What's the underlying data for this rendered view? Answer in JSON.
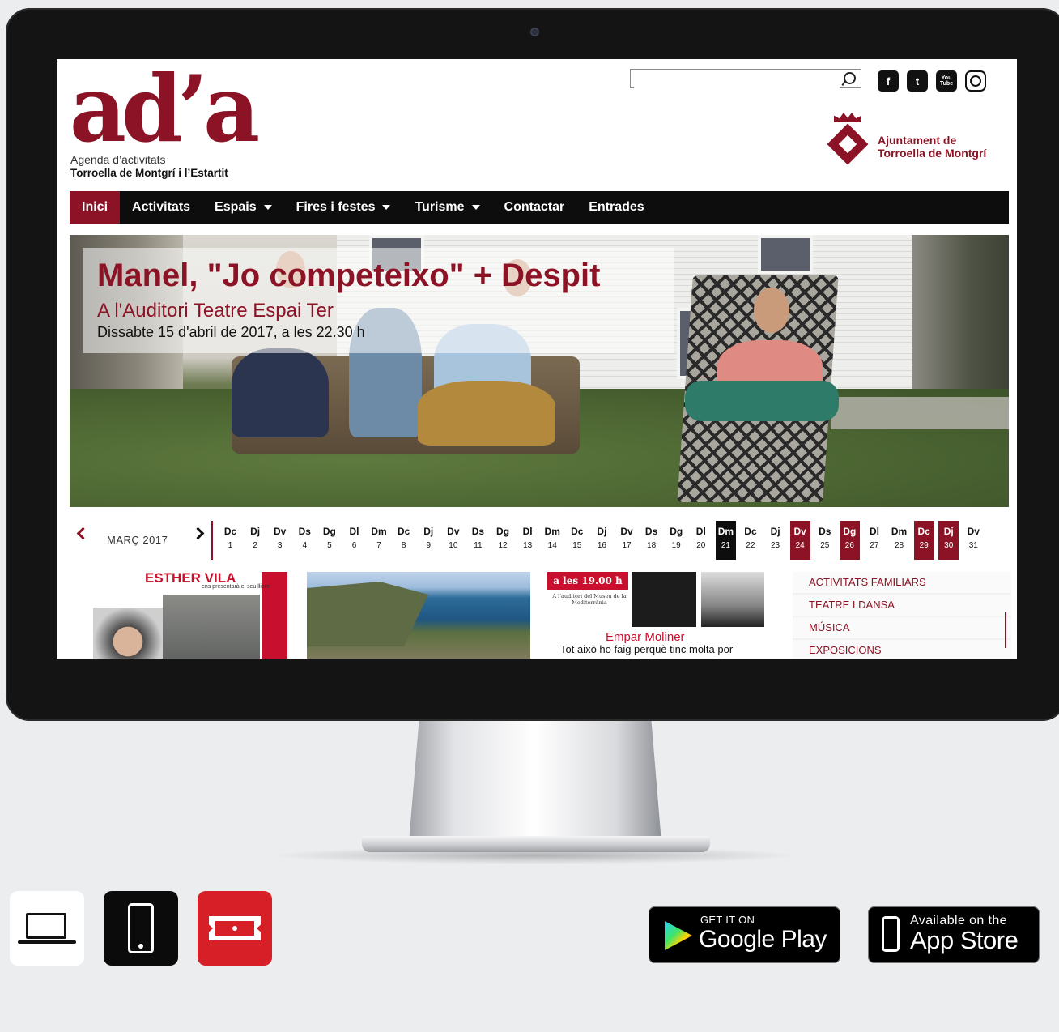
{
  "logo": {
    "mark": "ad’a",
    "subtitle": "Agenda d’activitats",
    "place": "Torroella de Montgrí i l’Estartit"
  },
  "search": {
    "value": "",
    "placeholder": ""
  },
  "social": [
    {
      "icon": "facebook-icon",
      "glyph": "f"
    },
    {
      "icon": "twitter-icon",
      "glyph": "t"
    },
    {
      "icon": "youtube-icon",
      "glyph": "You Tube"
    },
    {
      "icon": "instagram-icon",
      "glyph": ""
    }
  ],
  "council": {
    "line1": "Ajuntament de",
    "line2": "Torroella de Montgrí"
  },
  "nav": {
    "items": [
      {
        "label": "Inici",
        "active": true,
        "dropdown": false
      },
      {
        "label": "Activitats",
        "active": false,
        "dropdown": false
      },
      {
        "label": "Espais",
        "active": false,
        "dropdown": true
      },
      {
        "label": "Fires i festes",
        "active": false,
        "dropdown": true
      },
      {
        "label": "Turisme",
        "active": false,
        "dropdown": true
      },
      {
        "label": "Contactar",
        "active": false,
        "dropdown": false
      },
      {
        "label": "Entrades",
        "active": false,
        "dropdown": false
      }
    ]
  },
  "hero": {
    "title": "Manel, \"Jo competeixo\" + Despit",
    "subtitle": "A l'Auditori Teatre Espai Ter",
    "date": "Dissabte 15 d'abril de 2017, a les 22.30 h"
  },
  "calendar": {
    "month": "MARÇ 2017",
    "days": [
      {
        "n": "Dc",
        "d": "1",
        "s": ""
      },
      {
        "n": "Dj",
        "d": "2",
        "s": ""
      },
      {
        "n": "Dv",
        "d": "3",
        "s": ""
      },
      {
        "n": "Ds",
        "d": "4",
        "s": ""
      },
      {
        "n": "Dg",
        "d": "5",
        "s": ""
      },
      {
        "n": "Dl",
        "d": "6",
        "s": ""
      },
      {
        "n": "Dm",
        "d": "7",
        "s": ""
      },
      {
        "n": "Dc",
        "d": "8",
        "s": ""
      },
      {
        "n": "Dj",
        "d": "9",
        "s": ""
      },
      {
        "n": "Dv",
        "d": "10",
        "s": ""
      },
      {
        "n": "Ds",
        "d": "11",
        "s": ""
      },
      {
        "n": "Dg",
        "d": "12",
        "s": ""
      },
      {
        "n": "Dl",
        "d": "13",
        "s": ""
      },
      {
        "n": "Dm",
        "d": "14",
        "s": ""
      },
      {
        "n": "Dc",
        "d": "15",
        "s": ""
      },
      {
        "n": "Dj",
        "d": "16",
        "s": ""
      },
      {
        "n": "Dv",
        "d": "17",
        "s": ""
      },
      {
        "n": "Ds",
        "d": "18",
        "s": ""
      },
      {
        "n": "Dg",
        "d": "19",
        "s": ""
      },
      {
        "n": "Dl",
        "d": "20",
        "s": ""
      },
      {
        "n": "Dm",
        "d": "21",
        "s": "today"
      },
      {
        "n": "Dc",
        "d": "22",
        "s": ""
      },
      {
        "n": "Dj",
        "d": "23",
        "s": ""
      },
      {
        "n": "Dv",
        "d": "24",
        "s": "hl"
      },
      {
        "n": "Ds",
        "d": "25",
        "s": ""
      },
      {
        "n": "Dg",
        "d": "26",
        "s": "hl"
      },
      {
        "n": "Dl",
        "d": "27",
        "s": ""
      },
      {
        "n": "Dm",
        "d": "28",
        "s": ""
      },
      {
        "n": "Dc",
        "d": "29",
        "s": "hl"
      },
      {
        "n": "Dj",
        "d": "30",
        "s": "hl"
      },
      {
        "n": "Dv",
        "d": "31",
        "s": ""
      }
    ]
  },
  "cards": {
    "c1": {
      "title": "ESTHER VILA",
      "small": "ens presentarà el seu llibre"
    },
    "c3": {
      "banner": "a les 19.00 h",
      "info": "A l'auditori del Museu de la Mediterrània",
      "name": "Empar Moliner",
      "text": "Tot això ho faig perquè tinc molta por"
    }
  },
  "categories": [
    "ACTIVITATS FAMILIARS",
    "TEATRE I DANSA",
    "MÚSICA",
    "EXPOSICIONS"
  ],
  "stores": {
    "google": {
      "small": "GET IT ON",
      "big": "Google Play"
    },
    "apple": {
      "small": "Available on the",
      "big": "App Store"
    }
  },
  "colors": {
    "brand": "#8b1325",
    "ticket": "#d61f26"
  }
}
